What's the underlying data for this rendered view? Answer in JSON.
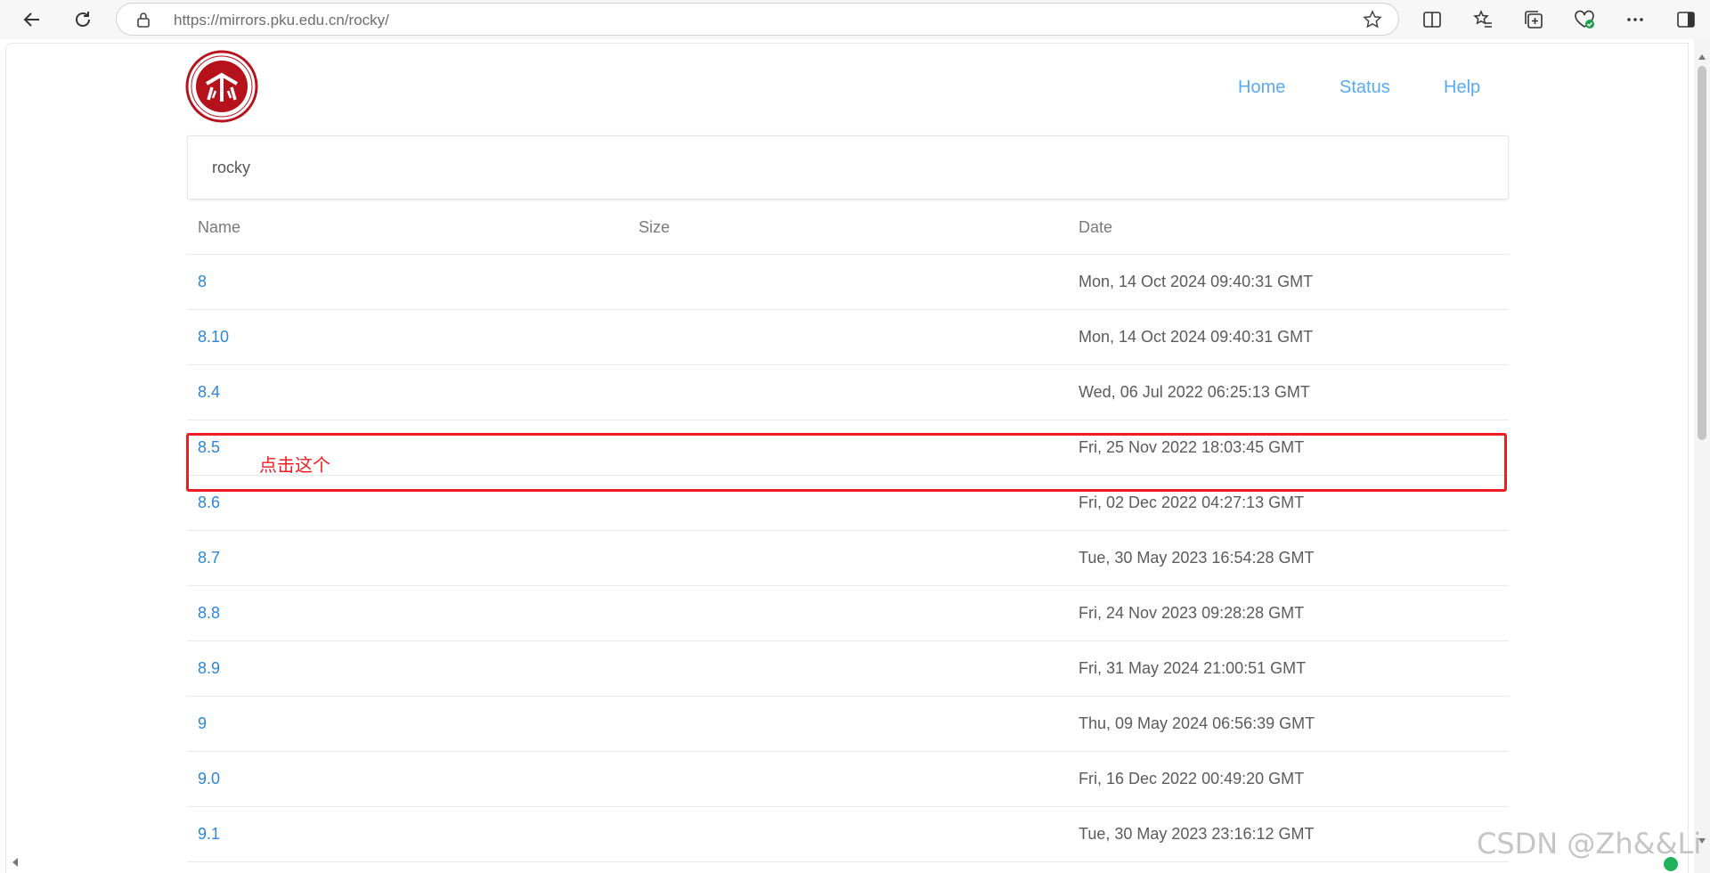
{
  "browser": {
    "url_host": "https://mirrors.pku.edu.cn",
    "url_path": "/rocky/"
  },
  "nav": {
    "home": "Home",
    "status": "Status",
    "help": "Help"
  },
  "breadcrumb": "rocky",
  "table": {
    "headers": {
      "name": "Name",
      "size": "Size",
      "date": "Date"
    },
    "rows": [
      {
        "name": "8",
        "size": "",
        "date": "Mon, 14 Oct 2024 09:40:31 GMT"
      },
      {
        "name": "8.10",
        "size": "",
        "date": "Mon, 14 Oct 2024 09:40:31 GMT"
      },
      {
        "name": "8.4",
        "size": "",
        "date": "Wed, 06 Jul 2022 06:25:13 GMT"
      },
      {
        "name": "8.5",
        "size": "",
        "date": "Fri, 25 Nov 2022 18:03:45 GMT"
      },
      {
        "name": "8.6",
        "size": "",
        "date": "Fri, 02 Dec 2022 04:27:13 GMT"
      },
      {
        "name": "8.7",
        "size": "",
        "date": "Tue, 30 May 2023 16:54:28 GMT"
      },
      {
        "name": "8.8",
        "size": "",
        "date": "Fri, 24 Nov 2023 09:28:28 GMT"
      },
      {
        "name": "8.9",
        "size": "",
        "date": "Fri, 31 May 2024 21:00:51 GMT"
      },
      {
        "name": "9",
        "size": "",
        "date": "Thu, 09 May 2024 06:56:39 GMT"
      },
      {
        "name": "9.0",
        "size": "",
        "date": "Fri, 16 Dec 2022 00:49:20 GMT"
      },
      {
        "name": "9.1",
        "size": "",
        "date": "Tue, 30 May 2023 23:16:12 GMT"
      }
    ]
  },
  "annotation": {
    "label": "点击这个",
    "color": "#ee1c24"
  },
  "watermark": "CSDN @Zh&&Li",
  "colors": {
    "nav_link": "#5aaaf0",
    "dir_link": "#2d86d9",
    "logo_red": "#b5121b"
  },
  "icons": [
    "back-icon",
    "refresh-icon",
    "lock-icon",
    "star-icon",
    "split-screen-icon",
    "favorites-icon",
    "collections-icon",
    "browser-essentials-icon",
    "more-icon",
    "sidebar-icon",
    "pku-logo"
  ]
}
